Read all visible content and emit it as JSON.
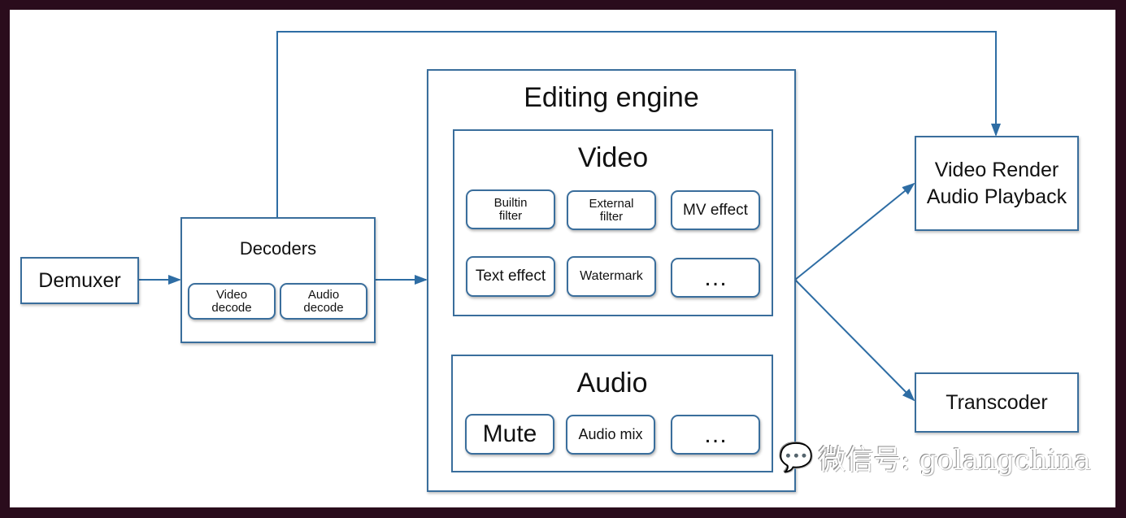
{
  "colors": {
    "line": "#2e6da4",
    "border": "#3a6e9c",
    "frame": "#2a0c1c"
  },
  "demuxer": {
    "label": "Demuxer"
  },
  "decoders": {
    "title": "Decoders",
    "items": [
      "Video decode",
      "Audio decode"
    ]
  },
  "engine": {
    "title": "Editing engine",
    "video": {
      "title": "Video",
      "items": [
        "Builtin filter",
        "External filter",
        "MV effect",
        "Text effect",
        "Watermark",
        "…"
      ]
    },
    "audio": {
      "title": "Audio",
      "items": [
        "Mute",
        "Audio mix",
        "…"
      ]
    }
  },
  "render": {
    "line1": "Video Render",
    "line2": "Audio Playback"
  },
  "transcoder": {
    "label": "Transcoder"
  },
  "watermark": {
    "text": "微信号: golangchina",
    "icon": "wechat-icon"
  }
}
